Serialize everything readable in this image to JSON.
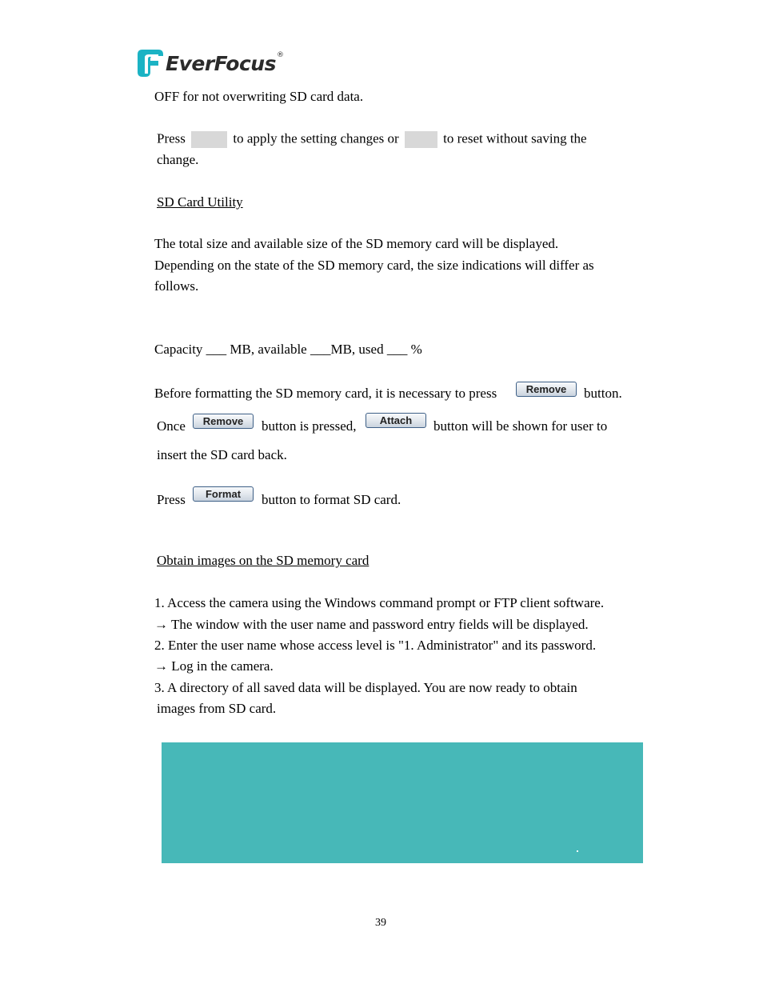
{
  "header": {
    "brand": "EverFocus",
    "brand_mark": "®",
    "logo_icon": "everfocus-f-logo-icon",
    "logo_color": "#1bb3c4"
  },
  "body": {
    "overwrite_text": "OFF for not overwriting SD card data.",
    "apply_reset": {
      "press": "Press",
      "mid": "to apply the setting changes or",
      "tail": "to reset without saving the",
      "line2": "change."
    },
    "sd_utility": {
      "heading": "SD Card Utility",
      "para_lines": [
        "The total size and available size of the SD memory card will be displayed.",
        "Depending on the state of the SD memory card, the size indications will differ as",
        "follows."
      ],
      "capacity_line": "Capacity ___ MB, available ___MB, used ___ %",
      "before_format": "Before formatting the SD memory card, it is necessary to press",
      "before_format_tail": "button.",
      "once": "Once",
      "once_mid": "button is pressed,",
      "once_tail": "button will be shown for user to",
      "insert_back": "insert the SD card back.",
      "press": "Press",
      "format_tail": "button to format SD card."
    },
    "buttons": {
      "remove": "Remove",
      "attach": "Attach",
      "format": "Format"
    },
    "obtain": {
      "heading": "Obtain images on the SD memory card",
      "steps": [
        "1. Access the camera using the Windows command prompt or FTP client software.",
        "→ The window with the user name and password entry fields will be displayed.",
        "2. Enter the user name whose access level is \"1. Administrator\" and its password.",
        "→ Log in the camera.",
        "3. A directory of all saved data will be displayed. You are now ready to obtain",
        "images from SD card."
      ]
    },
    "image_box_color": "#47b8b8"
  },
  "footer": {
    "page_number": "39"
  }
}
